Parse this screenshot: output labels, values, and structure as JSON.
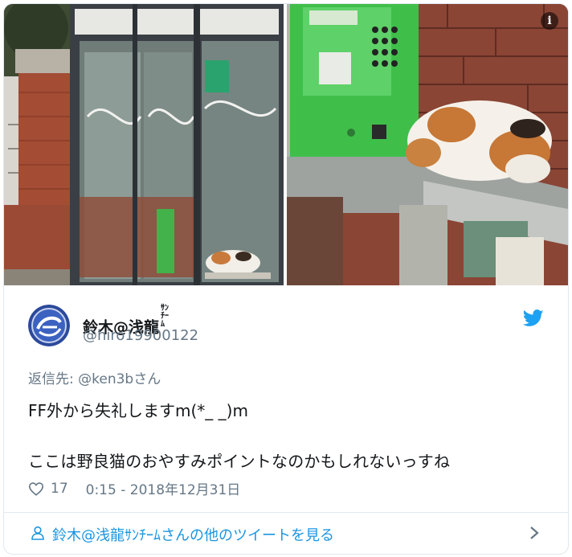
{
  "media": {
    "info_icon_glyph": "i",
    "left_image": "phone-booth-with-cat-icon",
    "right_image": "cat-sleeping-under-payphone-icon"
  },
  "author": {
    "display_name": "鈴木@浅龍",
    "display_name_suffix": "ｻﾝﾁｰﾑ",
    "handle": "@hiro19900122",
    "avatar_icon": "avatar-logo-icon"
  },
  "tweet": {
    "reply_prefix": "返信先: ",
    "reply_to_user": "@ken3bさん",
    "line1": "FF外から失礼しますm(*_ _)m",
    "line2": "ここは野良猫のおやすみポイントなのかもしれないっすね",
    "likes": "17",
    "timestamp": "0:15 - 2018年12月31日"
  },
  "footer": {
    "more_tweets_label": "鈴木@浅龍ｻﾝﾁｰﾑさんの他のツイートを見る"
  },
  "colors": {
    "link_blue": "#1b95e0",
    "twitter_blue": "#1da1f2",
    "muted_gray": "#657786",
    "border": "#e1e8ed"
  }
}
